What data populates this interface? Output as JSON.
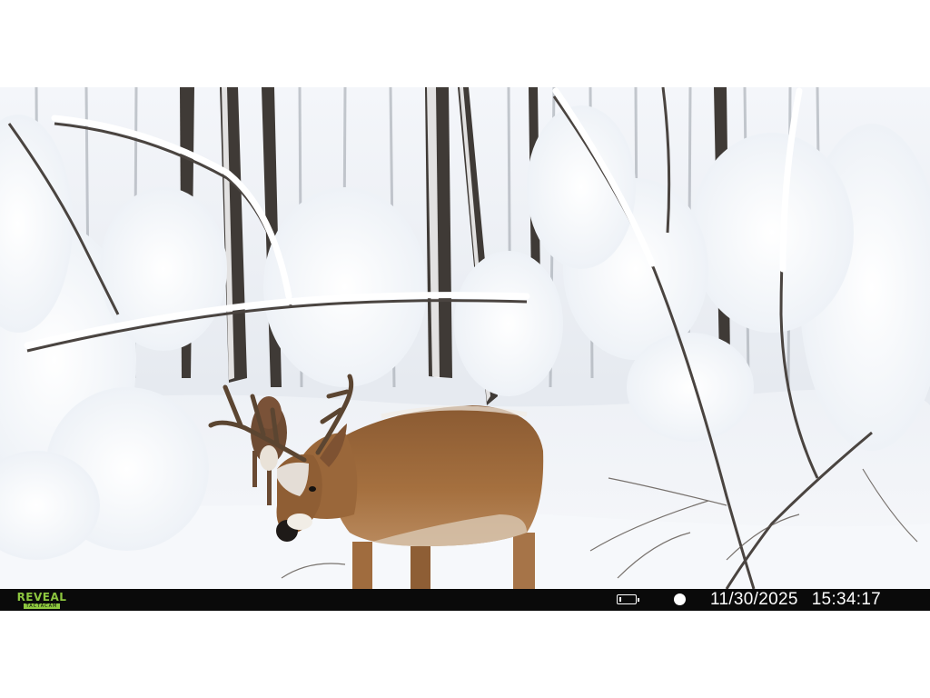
{
  "camera_overlay": {
    "brand": "REVEAL",
    "brand_sub": "TACTACAM",
    "brand_color": "#8dc63f",
    "battery_icon": "battery-icon",
    "battery_level": 0.12,
    "moon_icon": "full-moon-icon",
    "date": "11/30/2025",
    "time": "15:34:17"
  },
  "scene": {
    "subject": "white-tailed deer in snowy forest",
    "background_color": "#ffffff"
  }
}
